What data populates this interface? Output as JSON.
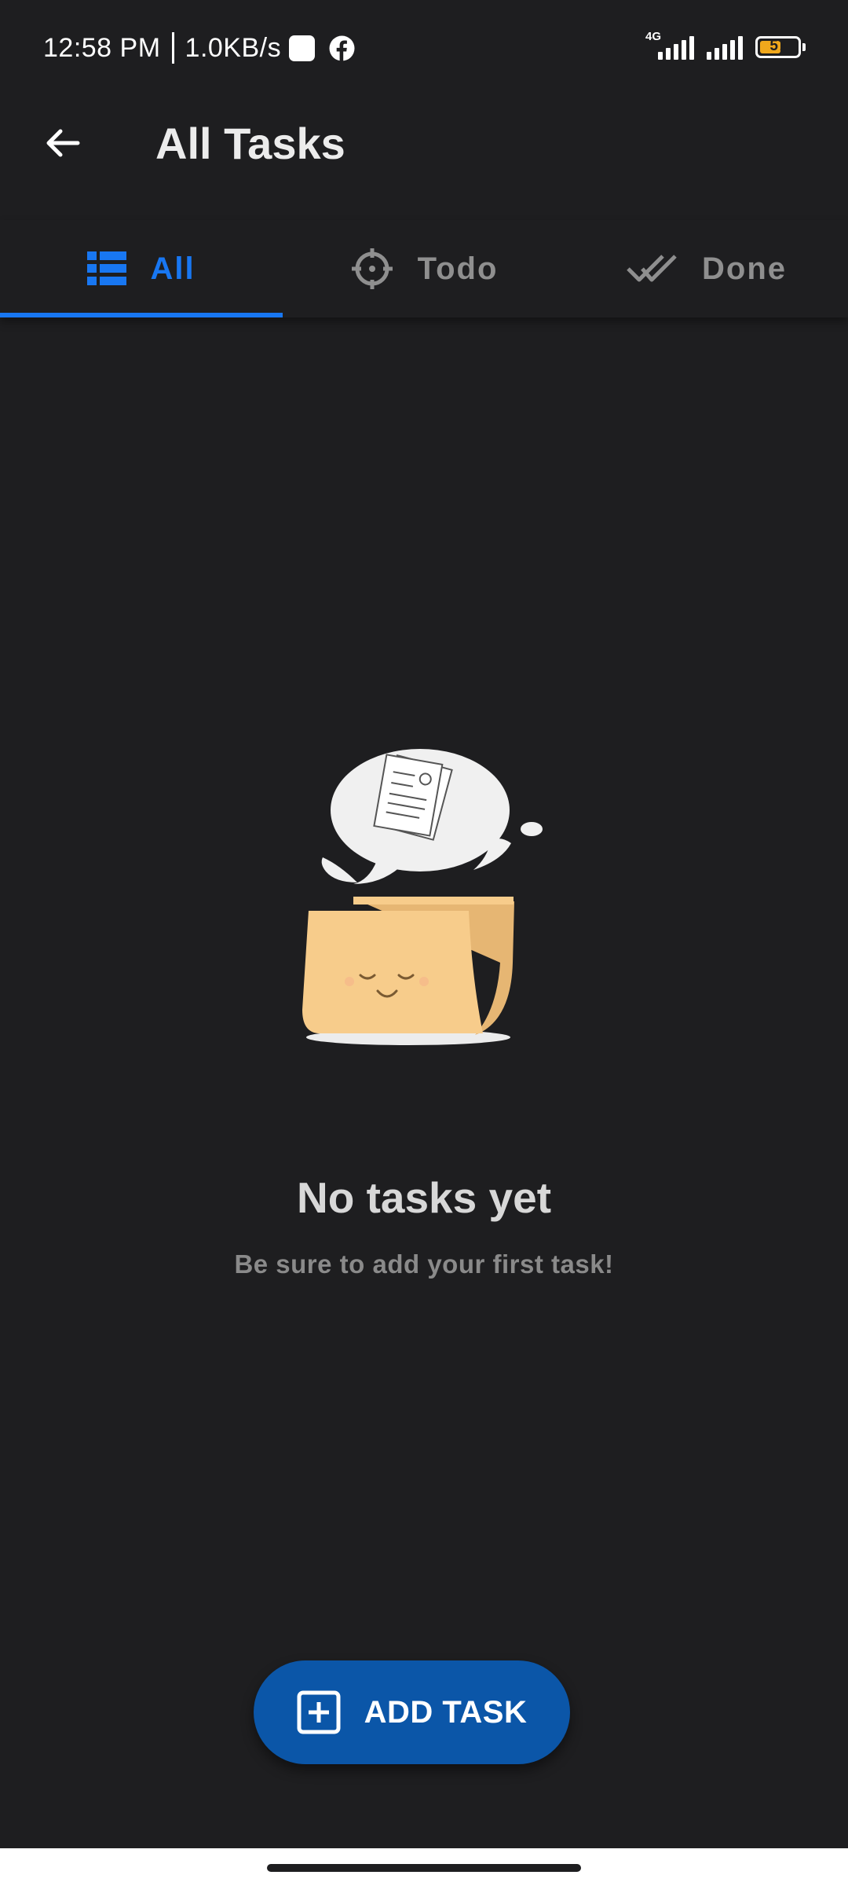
{
  "status_bar": {
    "time": "12:58 PM",
    "net_speed": "1.0KB/s",
    "network_type": "4G",
    "battery_level": "57",
    "battery_fraction": 0.57,
    "notification_icons": [
      "square-notification-icon",
      "facebook-icon"
    ]
  },
  "app_bar": {
    "title": "All Tasks",
    "back_icon": "arrow-left-icon"
  },
  "tabs": [
    {
      "label": "All",
      "icon": "list-icon",
      "active": true
    },
    {
      "label": "Todo",
      "icon": "crosshair-icon",
      "active": false
    },
    {
      "label": "Done",
      "icon": "double-check-icon",
      "active": false
    }
  ],
  "empty_state": {
    "title": "No tasks yet",
    "subtitle": "Be sure to add your first task!",
    "illustration": "happy-folder-illustration"
  },
  "fab": {
    "label": "ADD TASK",
    "icon": "plus-square-icon"
  },
  "colors": {
    "background": "#1e1e20",
    "accent": "#1877f2",
    "fab": "#0b56a8",
    "inactive_tab": "#8f8f8f",
    "battery": "#f0a81c"
  }
}
